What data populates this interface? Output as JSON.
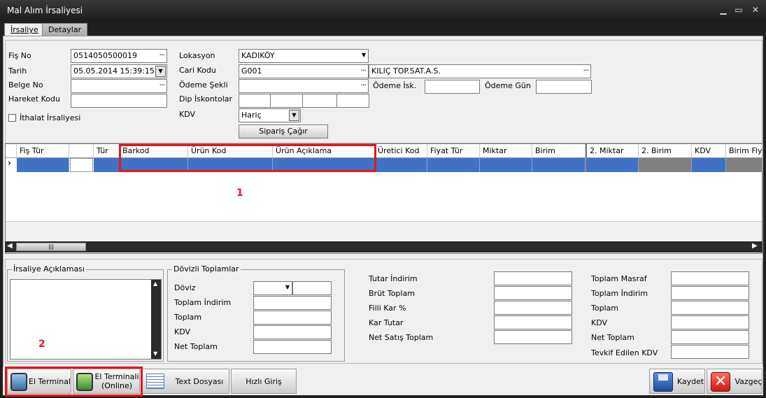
{
  "window": {
    "title": "Mal Alım İrsaliyesi",
    "min_icon": "minimize-icon",
    "max_icon": "maximize-icon",
    "close_icon": "close-icon"
  },
  "tabs": [
    {
      "label": "İrsaliye",
      "active": true
    },
    {
      "label": "Detaylar",
      "active": false
    }
  ],
  "header_form": {
    "fis_no": {
      "label": "Fiş No",
      "value": "0514050500019"
    },
    "tarih": {
      "label": "Tarih",
      "value": "05.05.2014 15:39:15"
    },
    "belge_no": {
      "label": "Belge No",
      "value": ""
    },
    "hareket_kodu": {
      "label": "Hareket Kodu",
      "value": ""
    },
    "ithalat": {
      "label": "İthalat İrsaliyesi",
      "checked": false
    },
    "lokasyon": {
      "label": "Lokasyon",
      "value": "KADIKÖY"
    },
    "cari_kodu": {
      "label": "Cari Kodu",
      "value": "G001",
      "name_value": "KILIÇ TOP.SAT.A.S."
    },
    "odeme_sekli": {
      "label": "Ödeme Şekli",
      "value": ""
    },
    "odeme_isk": {
      "label": "Ödeme İsk.",
      "value": ""
    },
    "odeme_gun": {
      "label": "Ödeme Gün",
      "value": ""
    },
    "dip_iskontolar": {
      "label": "Dip İskontolar"
    },
    "kdv": {
      "label": "KDV",
      "value": "Hariç"
    },
    "siparis_button": "Sipariş Çağır"
  },
  "grid": {
    "columns": [
      "Fiş Tür",
      "",
      "Tür",
      "Barkod",
      "Ürün Kod",
      "Ürün Açıklama",
      "Üretici Kod",
      "Fiyat Tür",
      "Miktar",
      "Birim",
      "2. Miktar",
      "2. Birim",
      "KDV",
      "Birim Fiya"
    ],
    "row_indicator": "›",
    "annotation_1": "1"
  },
  "aciklama": {
    "title": "İrsaliye Açıklaması",
    "annotation_2": "2"
  },
  "dovizli": {
    "title": "Dövizli Toplamlar",
    "doviz": "Döviz",
    "toplam_indirim": "Toplam İndirim",
    "toplam": "Toplam",
    "kdv": "KDV",
    "net_toplam": "Net Toplam"
  },
  "totals_mid": [
    "Tutar İndirim",
    "Brüt Toplam",
    "Fiili Kar %",
    "Kar Tutar",
    "Net Satış Toplam"
  ],
  "totals_right": [
    "Toplam Masraf",
    "Toplam İndirim",
    "Toplam",
    "KDV",
    "Net Toplam",
    "Tevkif Edilen KDV"
  ],
  "toolbar": {
    "el_terminal": "El Terminal",
    "el_terminal_online_1": "El Terminali",
    "el_terminal_online_2": "(Online)",
    "text_dosyasi": "Text Dosyası",
    "hizli_giris": "Hızlı Giriş",
    "kaydet": "Kaydet",
    "vazgec": "Vazgeç"
  },
  "colors": {
    "selection": "#3f72c4",
    "annotation": "#e8141e"
  }
}
